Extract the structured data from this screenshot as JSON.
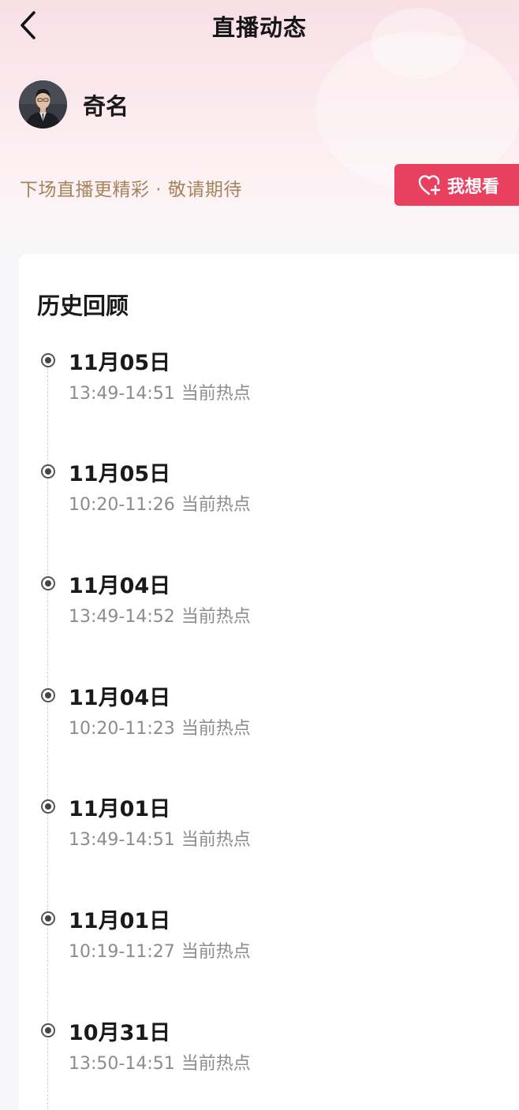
{
  "header": {
    "title": "直播动态",
    "back_icon": "chevron-left-icon"
  },
  "profile": {
    "name": "奇名"
  },
  "tagline": "下场直播更精彩 · 敬请期待",
  "want_button": {
    "label": "我想看",
    "icon": "heart-plus-icon"
  },
  "history": {
    "title": "历史回顾",
    "items": [
      {
        "date": "11月05日",
        "time": "13:49-14:51",
        "tag": "当前热点"
      },
      {
        "date": "11月05日",
        "time": "10:20-11:26",
        "tag": "当前热点"
      },
      {
        "date": "11月04日",
        "time": "13:49-14:52",
        "tag": "当前热点"
      },
      {
        "date": "11月04日",
        "time": "10:20-11:23",
        "tag": "当前热点"
      },
      {
        "date": "11月01日",
        "time": "13:49-14:51",
        "tag": "当前热点"
      },
      {
        "date": "11月01日",
        "time": "10:19-11:27",
        "tag": "当前热点"
      },
      {
        "date": "10月31日",
        "time": "13:50-14:51",
        "tag": "当前热点"
      }
    ]
  },
  "colors": {
    "accent": "#e94060",
    "tagline": "#a5845c",
    "subtext": "#8c8c8c"
  }
}
